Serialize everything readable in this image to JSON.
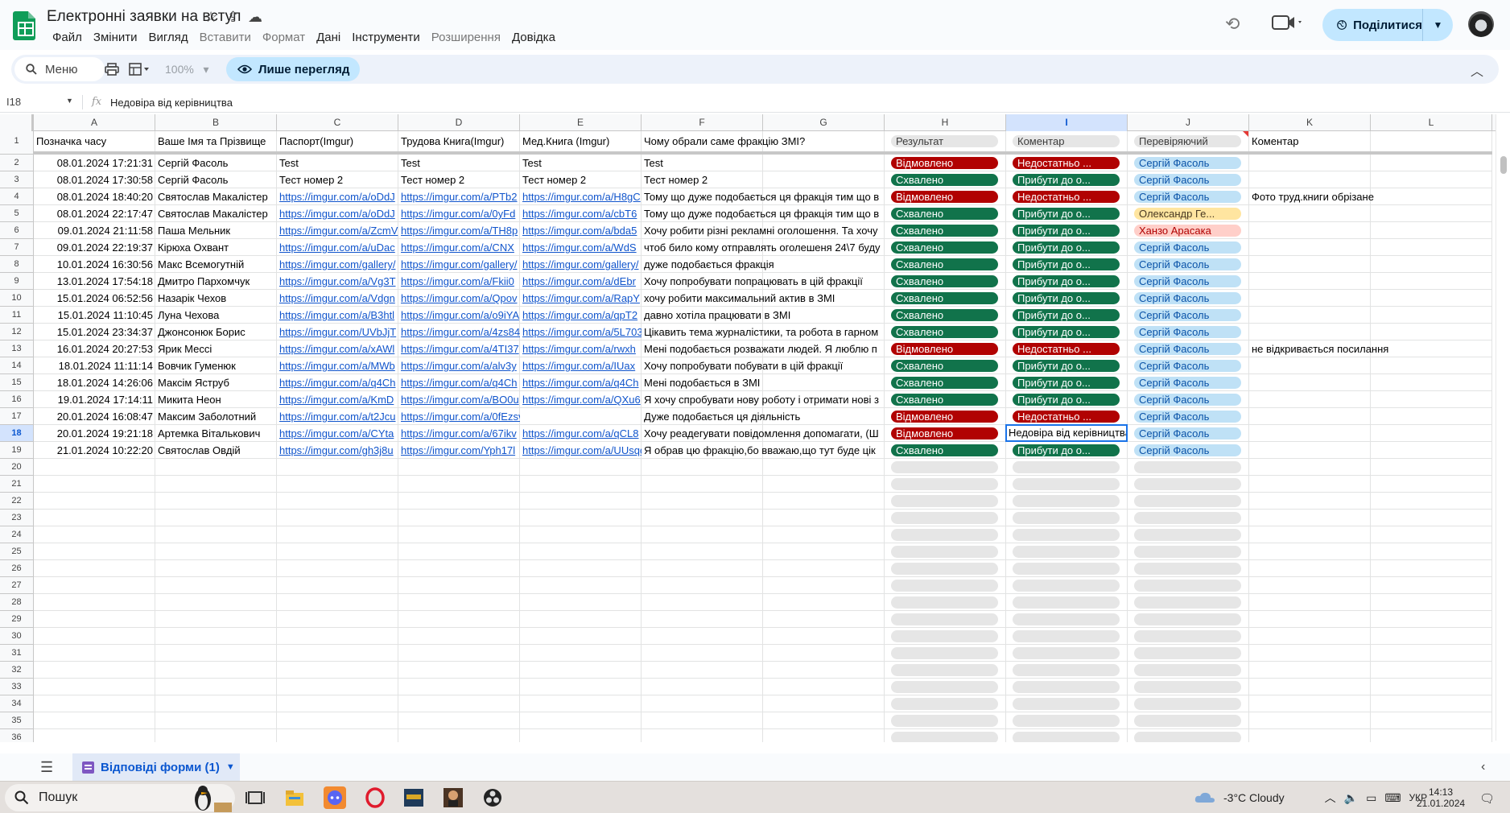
{
  "doc": {
    "title": "Електронні заявки на вступ",
    "menu": [
      "Файл",
      "Змінити",
      "Вигляд",
      "Вставити",
      "Формат",
      "Дані",
      "Інструменти",
      "Розширення",
      "Довідка"
    ],
    "menu_disabled": [
      false,
      false,
      false,
      true,
      true,
      false,
      false,
      true,
      false
    ],
    "share_label": "Поділитися"
  },
  "toolbar": {
    "search_label": "Меню",
    "zoom": "100%",
    "view_only_label": "Лише перегляд"
  },
  "formula_bar": {
    "cell_ref": "I18",
    "value": "Недовіра від керівництва"
  },
  "grid": {
    "columns": [
      "A",
      "B",
      "C",
      "D",
      "E",
      "F",
      "G",
      "H",
      "I",
      "J",
      "K",
      "L"
    ],
    "selected_column": "I",
    "selected_row": 18,
    "row_numbers": [
      1,
      2,
      3,
      4,
      5,
      6,
      7,
      8,
      9,
      10,
      11,
      12,
      13,
      14,
      15,
      16,
      17,
      18,
      19,
      20,
      21,
      22,
      23,
      24,
      25,
      26,
      27,
      28,
      29,
      30,
      31,
      32,
      33,
      34,
      35,
      36
    ],
    "header_row": [
      "Позначка часу",
      "Ваше Імя та Прізвище",
      "Паспорт(Imgur)",
      "Трудова Книга(Imgur)",
      "Мед.Книга (Imgur)",
      "Чому обрали саме фракцію ЗМІ?",
      "",
      "Результат",
      "Коментар",
      "Перевіряючий",
      "Коментар",
      ""
    ],
    "rows": [
      {
        "ts": "08.01.2024 17:21:31",
        "name": "Сергій Фасоль",
        "passport": "Test",
        "work": "Test",
        "med": "Test",
        "why": "Test",
        "result": "Відмовлено",
        "rc": "red",
        "comment": "Недостатньо ...",
        "cc": "red",
        "checker": "Сергій Фасоль",
        "kc": "blue",
        "note": ""
      },
      {
        "ts": "08.01.2024 17:30:58",
        "name": "Сергій Фасоль",
        "passport": "Тест номер 2",
        "work": "Тест номер 2",
        "med": "Тест номер 2",
        "why": "Тест номер 2",
        "result": "Схвалено",
        "rc": "green",
        "comment": "Прибути до о...",
        "cc": "green",
        "checker": "Сергій Фасоль",
        "kc": "blue",
        "note": ""
      },
      {
        "ts": "08.01.2024 18:40:20",
        "name": "Святослав Макалістер",
        "passport": "https://imgur.com/a/oDdJ",
        "work": "https://imgur.com/a/PTb2",
        "med": "https://imgur.com/a/H8gC",
        "why": "Тому що дуже подобається ця фракція тим що в",
        "result": "Відмовлено",
        "rc": "red",
        "comment": "Недостатньо ...",
        "cc": "red",
        "checker": "Сергій Фасоль",
        "kc": "blue",
        "note": "Фото труд.книги обрізане"
      },
      {
        "ts": "08.01.2024 22:17:47",
        "name": "Святослав Макалістер",
        "passport": "https://imgur.com/a/oDdJ",
        "work": "https://imgur.com/a/0yFd",
        "med": "https://imgur.com/a/cbT6",
        "why": "Тому що дуже подобається ця фракція тим що в",
        "result": "Схвалено",
        "rc": "green",
        "comment": "Прибути до о...",
        "cc": "green",
        "checker": "Олександр Ге...",
        "kc": "yellow",
        "note": ""
      },
      {
        "ts": "09.01.2024 21:11:58",
        "name": "Паша Мельник",
        "passport": "https://imgur.com/a/ZcmV",
        "work": "https://imgur.com/a/TH8p",
        "med": "https://imgur.com/a/bda5",
        "why": "Хочу робити різні рекламні оголошення. Та хочу",
        "result": "Схвалено",
        "rc": "green",
        "comment": "Прибути до о...",
        "cc": "green",
        "checker": "Ханзо Арасака",
        "kc": "pink",
        "note": ""
      },
      {
        "ts": "09.01.2024 22:19:37",
        "name": "Кірюха Охвант",
        "passport": "https://imgur.com/a/uDac",
        "work": "https://imgur.com/a/CNX",
        "med": "https://imgur.com/a/WdS",
        "why": "чтоб било кому отправлять оголешеня 24\\7 буду",
        "result": "Схвалено",
        "rc": "green",
        "comment": "Прибути до о...",
        "cc": "green",
        "checker": "Сергій Фасоль",
        "kc": "blue",
        "note": ""
      },
      {
        "ts": "10.01.2024 16:30:56",
        "name": "Макс Всемогутній",
        "passport": "https://imgur.com/gallery/",
        "work": "https://imgur.com/gallery/",
        "med": "https://imgur.com/gallery/",
        "why": "дуже подобається фракція",
        "result": "Схвалено",
        "rc": "green",
        "comment": "Прибути до о...",
        "cc": "green",
        "checker": "Сергій Фасоль",
        "kc": "blue",
        "note": ""
      },
      {
        "ts": "13.01.2024 17:54:18",
        "name": "Дмитро Пархомчук",
        "passport": "https://imgur.com/a/Vg3T",
        "work": "https://imgur.com/a/Fkii0",
        "med": "https://imgur.com/a/dEbr",
        "why": "Хочу попробувати попрацювать в цій фракції",
        "result": "Схвалено",
        "rc": "green",
        "comment": "Прибути до о...",
        "cc": "green",
        "checker": "Сергій Фасоль",
        "kc": "blue",
        "note": ""
      },
      {
        "ts": "15.01.2024 06:52:56",
        "name": "Назарік Чехов",
        "passport": "https://imgur.com/a/Vdgn",
        "work": "https://imgur.com/a/Qpov",
        "med": "https://imgur.com/a/RapY",
        "why": "хочу робити максимальний актив в ЗМІ",
        "result": "Схвалено",
        "rc": "green",
        "comment": "Прибути до о...",
        "cc": "green",
        "checker": "Сергій Фасоль",
        "kc": "blue",
        "note": ""
      },
      {
        "ts": "15.01.2024 11:10:45",
        "name": "Луна Чехова",
        "passport": "https://imgur.com/a/B3htl",
        "work": "https://imgur.com/a/o9iYA",
        "med": "https://imgur.com/a/qpT2",
        "why": "давно хотіла працювати в ЗМІ",
        "result": "Схвалено",
        "rc": "green",
        "comment": "Прибути до о...",
        "cc": "green",
        "checker": "Сергій Фасоль",
        "kc": "blue",
        "note": ""
      },
      {
        "ts": "15.01.2024 23:34:37",
        "name": "Джонсонюк Борис",
        "passport": "https://imgur.com/UVbJjT",
        "work": "https://imgur.com/a/4zs84C",
        "med": "https://imgur.com/a/5L703F",
        "why": "Цікавить тема журналістики, та робота в гарном",
        "result": "Схвалено",
        "rc": "green",
        "comment": "Прибути до о...",
        "cc": "green",
        "checker": "Сергій Фасоль",
        "kc": "blue",
        "note": ""
      },
      {
        "ts": "16.01.2024 20:27:53",
        "name": "Ярик Мессі",
        "passport": "https://imgur.com/a/xAWl",
        "work": "https://imgur.com/a/4TI37",
        "med": "https://imgur.com/a/rwxh",
        "why": "Мені подобається розважати людей. Я люблю п",
        "result": "Відмовлено",
        "rc": "red",
        "comment": "Недостатньо ...",
        "cc": "red",
        "checker": "Сергій Фасоль",
        "kc": "blue",
        "note": "не відкривається посилання"
      },
      {
        "ts": "18.01.2024 11:11:14",
        "name": "Вовчик Гуменюк",
        "passport": "https://imgur.com/a/MWb",
        "work": "https://imgur.com/a/alv3y",
        "med": "https://imgur.com/a/IUax",
        "why": "Хочу попробувати побувати в цій фракції",
        "result": "Схвалено",
        "rc": "green",
        "comment": "Прибути до о...",
        "cc": "green",
        "checker": "Сергій Фасоль",
        "kc": "blue",
        "note": ""
      },
      {
        "ts": "18.01.2024 14:26:06",
        "name": "Максім Яструб",
        "passport": "https://imgur.com/a/q4Ch",
        "work": "https://imgur.com/a/q4Ch",
        "med": "https://imgur.com/a/q4Ch",
        "why": "Мені подобається в ЗМІ",
        "result": "Схвалено",
        "rc": "green",
        "comment": "Прибути до о...",
        "cc": "green",
        "checker": "Сергій Фасоль",
        "kc": "blue",
        "note": ""
      },
      {
        "ts": "19.01.2024 17:14:11",
        "name": "Микита Неон",
        "passport": "https://imgur.com/a/KmD",
        "work": "https://imgur.com/a/BO0u",
        "med": "https://imgur.com/a/QXu6",
        "why": "Я хочу спробувати нову роботу і отримати нові з",
        "result": "Схвалено",
        "rc": "green",
        "comment": "Прибути до о...",
        "cc": "green",
        "checker": "Сергій Фасоль",
        "kc": "blue",
        "note": ""
      },
      {
        "ts": "20.01.2024 16:08:47",
        "name": "Максим Заболотний",
        "passport": "https://imgur.com/a/t2Jcu",
        "work": "https://imgur.com/a/0fEzsvg",
        "med": "",
        "why": "Дуже подобається ця діяльність",
        "result": "Відмовлено",
        "rc": "red",
        "comment": "Недостатньо ...",
        "cc": "red",
        "checker": "Сергій Фасоль",
        "kc": "blue",
        "note": ""
      },
      {
        "ts": "20.01.2024 19:21:18",
        "name": "Артемка Віталькович",
        "passport": "https://imgur.com/a/CYta",
        "work": "https://imgur.com/a/67ikv",
        "med": "https://imgur.com/a/qCL8",
        "why": "Хочу реадегувати повідомлення допомагати, (Ш",
        "result": "Відмовлено",
        "rc": "red",
        "comment": "Недовіра від керівництва",
        "cc": "active",
        "checker": "Сергій Фасоль",
        "kc": "blue",
        "note": ""
      },
      {
        "ts": "21.01.2024 10:22:20",
        "name": "Святослав Овдій",
        "passport": "https://imgur.com/gh3j8u",
        "work": "https://imgur.com/Yph17l",
        "med": "https://imgur.com/a/UUsqd",
        "why": "Я обрав цю фракцію,бо вважаю,що тут буде цік",
        "result": "Схвалено",
        "rc": "green",
        "comment": "Прибути до о...",
        "cc": "green",
        "checker": "Сергій Фасоль",
        "kc": "blue",
        "note": ""
      }
    ]
  },
  "sheet_tab": {
    "label": "Відповіді форми (1)"
  },
  "taskbar": {
    "search_label": "Пошук",
    "weather": "-3°C  Cloudy",
    "lang": "УКР",
    "time": "14:13",
    "date": "21.01.2024"
  },
  "colors": {
    "accent": "#0b57d0",
    "share_bg": "#c2e7ff",
    "rejected": "#b10202",
    "approved": "#11734b",
    "checker_chip": "#bfe1f6"
  }
}
